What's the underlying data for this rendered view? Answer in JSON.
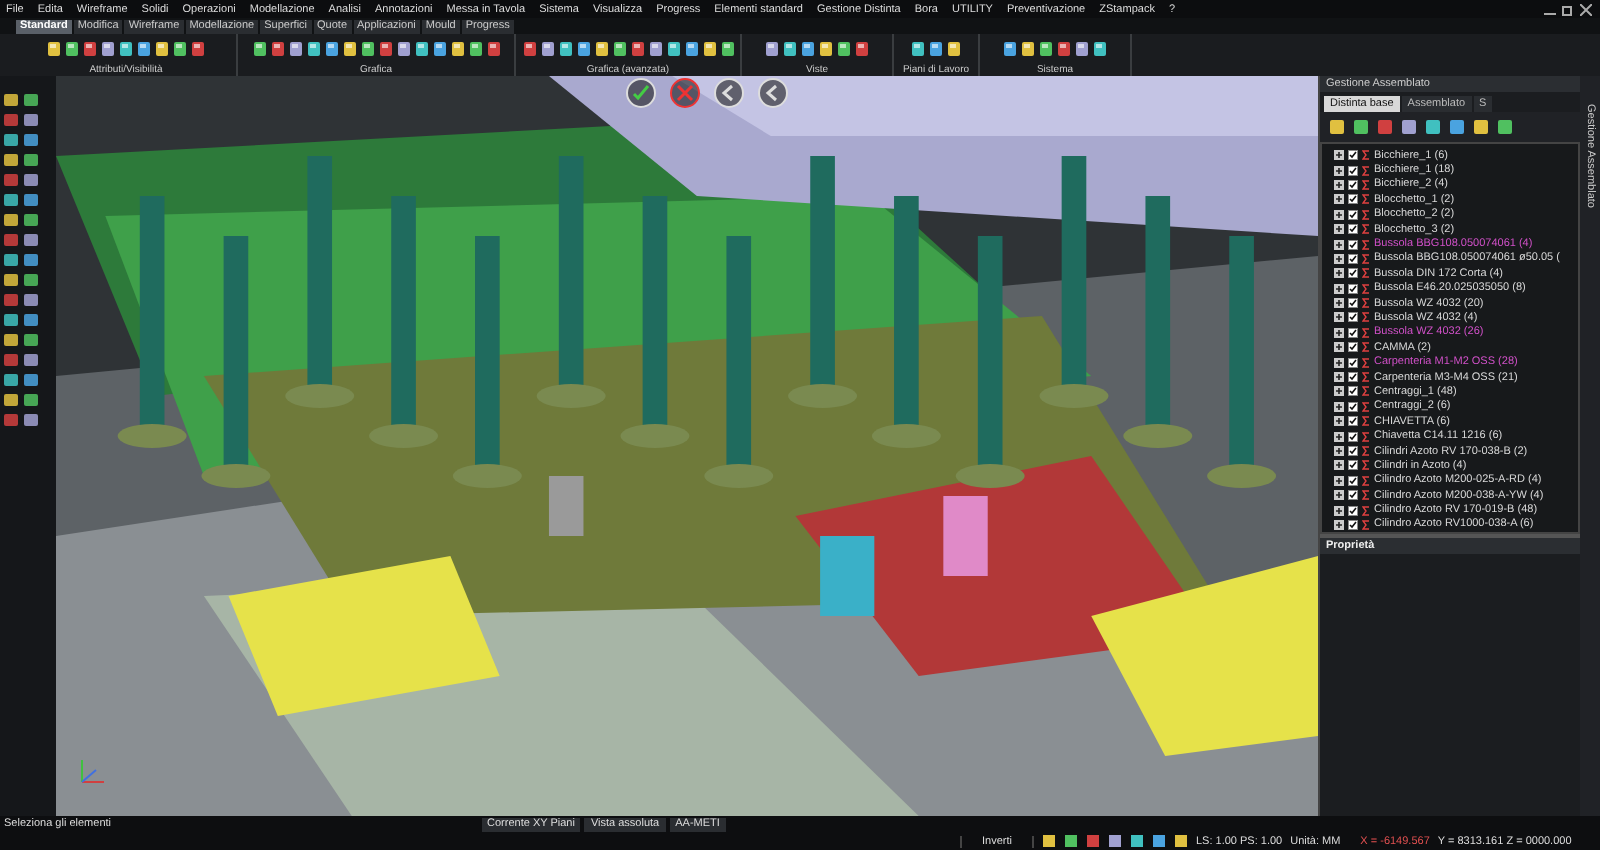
{
  "menu": [
    "File",
    "Edita",
    "Wireframe",
    "Solidi",
    "Operazioni",
    "Modellazione",
    "Analisi",
    "Annotazioni",
    "Messa in Tavola",
    "Sistema",
    "Visualizza",
    "Progress",
    "Elementi standard",
    "Gestione Distinta",
    "Bora",
    "UTILITY",
    "Preventivazione",
    "ZStampack",
    "?"
  ],
  "ribbon_tabs": [
    {
      "label": "Standard",
      "selected": true
    },
    {
      "label": "Modifica",
      "selected": false
    },
    {
      "label": "Wireframe",
      "selected": false
    },
    {
      "label": "Modellazione",
      "selected": false
    },
    {
      "label": "Superfici",
      "selected": false
    },
    {
      "label": "Quote",
      "selected": false
    },
    {
      "label": "Applicazioni",
      "selected": false
    },
    {
      "label": "Mould",
      "selected": false
    },
    {
      "label": "Progress",
      "selected": false
    }
  ],
  "toolbar_groups": [
    "Attributi/Visibilità",
    "Grafica",
    "Grafica (avanzata)",
    "Viste",
    "Piani di Lavoro",
    "Sistema"
  ],
  "panel": {
    "title": "Gestione Assemblato",
    "side_label": "Gestione Assemblato",
    "tabs": [
      {
        "label": "Distinta base",
        "selected": true
      },
      {
        "label": "Assemblato",
        "selected": false
      },
      {
        "label": "S",
        "selected": false
      }
    ],
    "items": [
      {
        "label": "Bicchiere_1 (6)",
        "checked": true,
        "highlighted": false
      },
      {
        "label": "Bicchiere_1 (18)",
        "checked": true,
        "highlighted": false
      },
      {
        "label": "Bicchiere_2 (4)",
        "checked": true,
        "highlighted": false
      },
      {
        "label": "Blocchetto_1 (2)",
        "checked": true,
        "highlighted": false
      },
      {
        "label": "Blocchetto_2 (2)",
        "checked": true,
        "highlighted": false
      },
      {
        "label": "Blocchetto_3 (2)",
        "checked": true,
        "highlighted": false
      },
      {
        "label": "Bussola BBG108.050074061 (4)",
        "checked": true,
        "highlighted": true
      },
      {
        "label": "Bussola BBG108.050074061 ø50.05 (",
        "checked": true,
        "highlighted": false
      },
      {
        "label": "Bussola DIN 172 Corta (4)",
        "checked": true,
        "highlighted": false
      },
      {
        "label": "Bussola E46.20.025035050 (8)",
        "checked": true,
        "highlighted": false
      },
      {
        "label": "Bussola WZ 4032 (20)",
        "checked": true,
        "highlighted": false
      },
      {
        "label": "Bussola WZ 4032 (4)",
        "checked": true,
        "highlighted": false
      },
      {
        "label": "Bussola WZ 4032 (26)",
        "checked": true,
        "highlighted": true
      },
      {
        "label": "CAMMA (2)",
        "checked": true,
        "highlighted": false
      },
      {
        "label": "Carpenteria M1-M2 OSS (28)",
        "checked": true,
        "highlighted": true
      },
      {
        "label": "Carpenteria M3-M4 OSS (21)",
        "checked": true,
        "highlighted": false
      },
      {
        "label": "Centraggi_1 (48)",
        "checked": true,
        "highlighted": false
      },
      {
        "label": "Centraggi_2 (6)",
        "checked": true,
        "highlighted": false
      },
      {
        "label": "CHIAVETTA (6)",
        "checked": true,
        "highlighted": false
      },
      {
        "label": "Chiavetta C14.11 1216 (6)",
        "checked": true,
        "highlighted": false
      },
      {
        "label": "Cilindri Azoto RV 170-038-B (2)",
        "checked": true,
        "highlighted": false
      },
      {
        "label": "Cilindri in Azoto (4)",
        "checked": true,
        "highlighted": false
      },
      {
        "label": "Cilindro Azoto M200-025-A-RD (4)",
        "checked": true,
        "highlighted": false
      },
      {
        "label": "Cilindro Azoto M200-038-A-YW (4)",
        "checked": true,
        "highlighted": false
      },
      {
        "label": "Cilindro Azoto RV 170-019-B (48)",
        "checked": true,
        "highlighted": false
      },
      {
        "label": "Cilindro Azoto RV1000-038-A (6)",
        "checked": true,
        "highlighted": false
      }
    ],
    "properties_title": "Proprietà"
  },
  "status": {
    "message": "Seleziona gli elementi",
    "view_fields": [
      "Corrente XY Piani",
      "Vista assoluta",
      "AA-METI"
    ],
    "invert": "Inverti",
    "scale": "LS: 1.00 PS: 1.00",
    "units": "Unità: MM",
    "coord_x": "X = -6149.567",
    "coord_yz": "Y = 8313.161 Z = 0000.000"
  }
}
